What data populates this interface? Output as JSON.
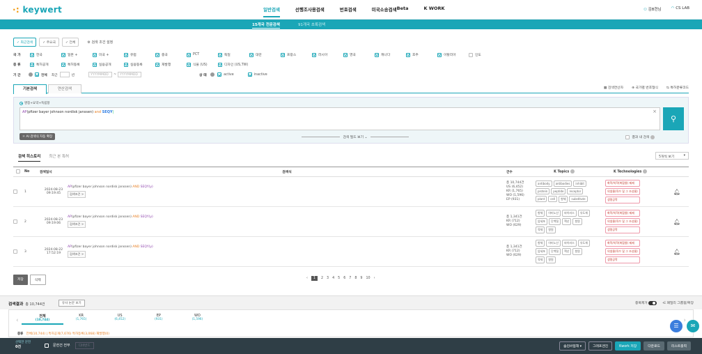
{
  "header": {
    "logo": "keywert",
    "nav": [
      "일반검색",
      "선행조사용검색",
      "번호검색",
      "미국소송검색",
      "K WORK"
    ],
    "beta": "Beta",
    "user": "김B현님",
    "lab": "CS LAB"
  },
  "subnav": [
    "15개국 전문검색",
    "91개국 초록검색"
  ],
  "chips": {
    "items": [
      "최근검색",
      "주요국",
      "전체"
    ],
    "settings": "검색 조건 설정"
  },
  "filters": {
    "country_label": "국 가",
    "countries": [
      {
        "name": "한국",
        "on": true
      },
      {
        "name": "일본 +",
        "on": true
      },
      {
        "name": "미국 +",
        "on": true
      },
      {
        "name": "유럽",
        "on": true
      },
      {
        "name": "중국",
        "on": true
      },
      {
        "name": "PCT",
        "on": true
      },
      {
        "name": "독일",
        "on": true
      },
      {
        "name": "대만",
        "on": true
      },
      {
        "name": "프랑스",
        "on": true
      },
      {
        "name": "러시아",
        "on": true
      },
      {
        "name": "영국",
        "on": true
      },
      {
        "name": "캐나다",
        "on": true
      },
      {
        "name": "호주",
        "on": true
      },
      {
        "name": "이탈리아",
        "on": true
      },
      {
        "name": "인도",
        "on": false
      }
    ],
    "type_label": "종 류",
    "types": [
      "특허공개",
      "특허등록",
      "실용공개",
      "실용등록",
      "재발행",
      "식물 (US)",
      "디자인 (US,TW)"
    ],
    "period_label": "기 간",
    "period_all": "전체",
    "period_recent": "최근",
    "period_unit": "년",
    "date_from": "YYYYMMDD",
    "date_to": "YYYYMMDD",
    "status_label": "상 태",
    "status": [
      "active",
      "inactive"
    ]
  },
  "search": {
    "tabs": [
      "기본검색",
      "연산검색"
    ],
    "tools": [
      "검색연산자",
      "국가별 번호형식",
      "특허분류코드"
    ],
    "field_label": "명칭+요약+독립항",
    "query_ap": "AP",
    "query_main": "(pfizer bayer johnson nordisk janssen)",
    "query_and": "and",
    "query_tail": "SEQY",
    "ai_button": "AI 검색식 자동 확장",
    "more_fields": "검색 필드 보기 ⌄",
    "in_result": "결과 내 검색"
  },
  "history": {
    "tabs": [
      "검색 히스토리",
      "최근 본 특허"
    ],
    "view": "5개씩 보기",
    "columns": [
      "No",
      "검색일시",
      "검색식",
      "건수",
      "K Topics",
      "K Technologies"
    ],
    "condition_label": "검색조건 >",
    "rows": [
      {
        "no": "1",
        "date": "2024-08-23",
        "time": "09:19:45",
        "query_ap": "AP",
        "query_main": "(pfizer bayer johnson nordisk janssen)",
        "query_and": "AND",
        "query_tail": "SEQY(y)",
        "counts": [
          "총 10,744건",
          "US (6,452)",
          "KR (1,765)",
          "WO (1,596)",
          "EP (931)"
        ],
        "topics": [
          "antibody",
          "antibodies",
          "inhibit",
          "protein",
          "peptide",
          "receptor",
          "plant",
          "cell",
          "항체",
          "substitute"
        ],
        "techs": [
          "화학/의학(화합물) 제제",
          "의생물(육수 및 그 조성물)",
          "생명공학"
        ]
      },
      {
        "no": "2",
        "date": "2024-08-23",
        "time": "09:19:06",
        "query_ap": "AP",
        "query_main": "(pfizer bayer johnson nordisk janssen)",
        "query_and": "AND",
        "query_tail": "SEQY(y)",
        "counts": [
          "총 1,341건",
          "KR (712)",
          "WO (629)"
        ],
        "topics": [
          "항체",
          "아미노산",
          "바이러스",
          "유도체",
          "암세포",
          "단백질",
          "핵산",
          "항원",
          "육체",
          "항원"
        ],
        "techs": [
          "화학/의학(화합물) 제제",
          "의생물(육수 및 그 조성물)",
          "생명공학"
        ]
      },
      {
        "no": "3",
        "date": "2024-08-22",
        "time": "17:52:19",
        "query_ap": "AP",
        "query_main": "(pfizer bayer johnson nordisk janssen)",
        "query_and": "AND",
        "query_tail": "SEQY(y)",
        "counts": [
          "총 1,341건",
          "KR (712)",
          "WO (629)"
        ],
        "topics": [
          "항체",
          "아미노산",
          "바이러스",
          "유도체",
          "암세포",
          "단백질",
          "핵산",
          "항원",
          "육체",
          "항원"
        ],
        "techs": [
          "화학/의학(화합물) 제제",
          "의생물(육수 및 그 조성물)",
          "생명공학"
        ]
      }
    ],
    "save_label": "저장",
    "delete_label": "삭제",
    "pages": [
      "1",
      "2",
      "3",
      "4",
      "5",
      "6",
      "7",
      "8",
      "9",
      "10"
    ]
  },
  "results": {
    "title": "검색결과",
    "count": "총 10,744건",
    "similar_button": "유사 논문 보기",
    "dedupe": "중복제거",
    "family": "패밀리 그룹핑/확장",
    "jurisdictions": [
      {
        "name": "전체",
        "count": "(10,744)"
      },
      {
        "name": "KR",
        "count": "(1,765)"
      },
      {
        "name": "US",
        "count": "(6,452)"
      },
      {
        "name": "EP",
        "count": "(931)"
      },
      {
        "name": "WO",
        "count": "(1,596)"
      }
    ],
    "filter_label": "종류",
    "filter_text": "전체(10,744) | 특허공개(7,676) 특허등록(3,068) 재발행(0)"
  },
  "bottom": {
    "selected_label": "선택한 문헌",
    "selected_count": "0건",
    "select_all": "문헌건 전부",
    "hide_btn": "디바번드",
    "buttons": [
      "숨김바뀜해",
      "그래프엔진",
      "Kwork 저장",
      "다운로드",
      "리스트출력"
    ]
  },
  "colors": {
    "accent": "#1aa6b7",
    "dark": "#2f3e46"
  }
}
